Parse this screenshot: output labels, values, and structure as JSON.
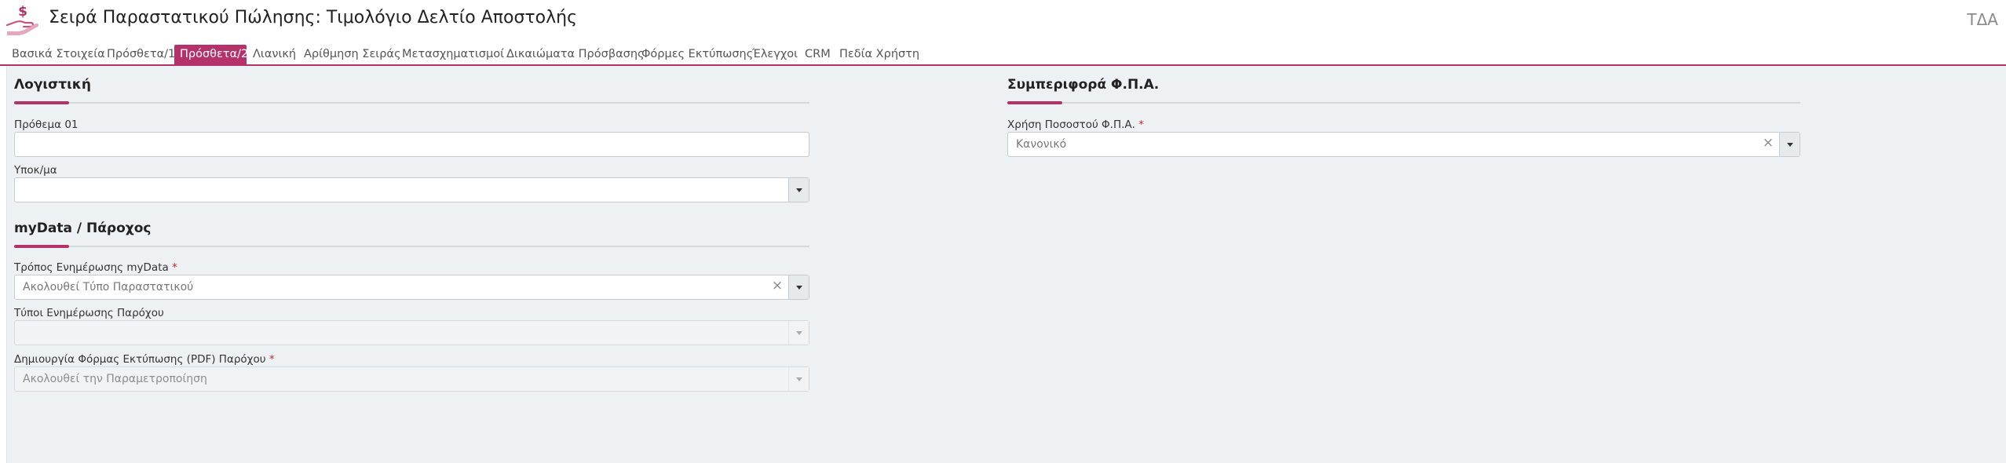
{
  "header": {
    "title": "Σειρά Παραστατικού Πώλησης: Τιμολόγιο Δελτίο Αποστολής",
    "code": "ΤΔΑ",
    "logo_icon": "money-hand-icon",
    "accent": "#b5316a"
  },
  "tabs": [
    {
      "label": "Βασικά Στοιχεία",
      "active": false
    },
    {
      "label": "Πρόσθετα/1",
      "active": false
    },
    {
      "label": "Πρόσθετα/2",
      "active": true
    },
    {
      "label": "Λιανική",
      "active": false
    },
    {
      "label": "Αρίθμηση Σειράς",
      "active": false
    },
    {
      "label": "Μετασχηματισμοί",
      "active": false
    },
    {
      "label": "Δικαιώματα Πρόσβασης",
      "active": false
    },
    {
      "label": "Φόρμες Εκτύπωσης",
      "active": false
    },
    {
      "label": "Έλεγχοι",
      "active": false
    },
    {
      "label": "CRM",
      "active": false
    },
    {
      "label": "Πεδία Χρήστη",
      "active": false
    }
  ],
  "accounting": {
    "title": "Λογιστική",
    "prefix_label": "Πρόθεμα 01",
    "prefix_value": "",
    "branch_label": "Υποκ/μα",
    "branch_value": ""
  },
  "mydata": {
    "title": "myData / Πάροχος",
    "update_mode_label": "Τρόπος Ενημέρωσης myData",
    "update_mode_value": "Ακολουθεί Τύπο Παραστατικού",
    "provider_types_label": "Τύποι Ενημέρωσης Παρόχου",
    "provider_types_value": "",
    "pdf_label": "Δημιουργία Φόρμας Εκτύπωσης (PDF) Παρόχου",
    "pdf_value": "Ακολουθεί την Παραμετροποίηση"
  },
  "vat": {
    "title": "Συμπεριφορά Φ.Π.Α.",
    "rate_usage_label": "Χρήση Ποσοστού Φ.Π.Α.",
    "rate_usage_value": "Κανονικό"
  },
  "required_marker": "*",
  "clear_glyph": "×"
}
